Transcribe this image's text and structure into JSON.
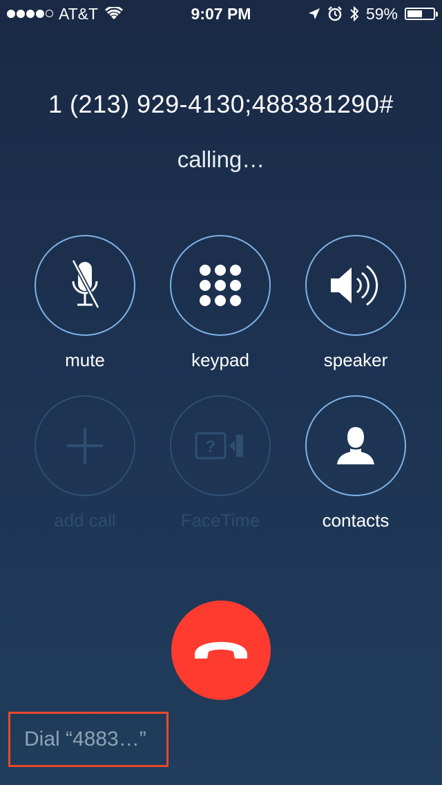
{
  "status_bar": {
    "carrier": "AT&T",
    "time": "9:07 PM",
    "battery_text": "59%",
    "battery_level": 0.59,
    "signal_bars_filled": 4,
    "signal_bars_total": 5,
    "icons": [
      "wifi-icon",
      "location-icon",
      "alarm-icon",
      "bluetooth-icon",
      "battery-icon"
    ]
  },
  "call": {
    "number": "1 (213) 929-4130;488381290#",
    "status": "calling…"
  },
  "buttons": {
    "mute": "mute",
    "keypad": "keypad",
    "speaker": "speaker",
    "add_call": "add call",
    "facetime": "FaceTime",
    "contacts": "contacts"
  },
  "dial_pending": {
    "label": "Dial “4883…”"
  },
  "colors": {
    "end_call": "#ff3b30",
    "button_ring": "#7fb3e6",
    "highlight_box": "#e8492a"
  }
}
